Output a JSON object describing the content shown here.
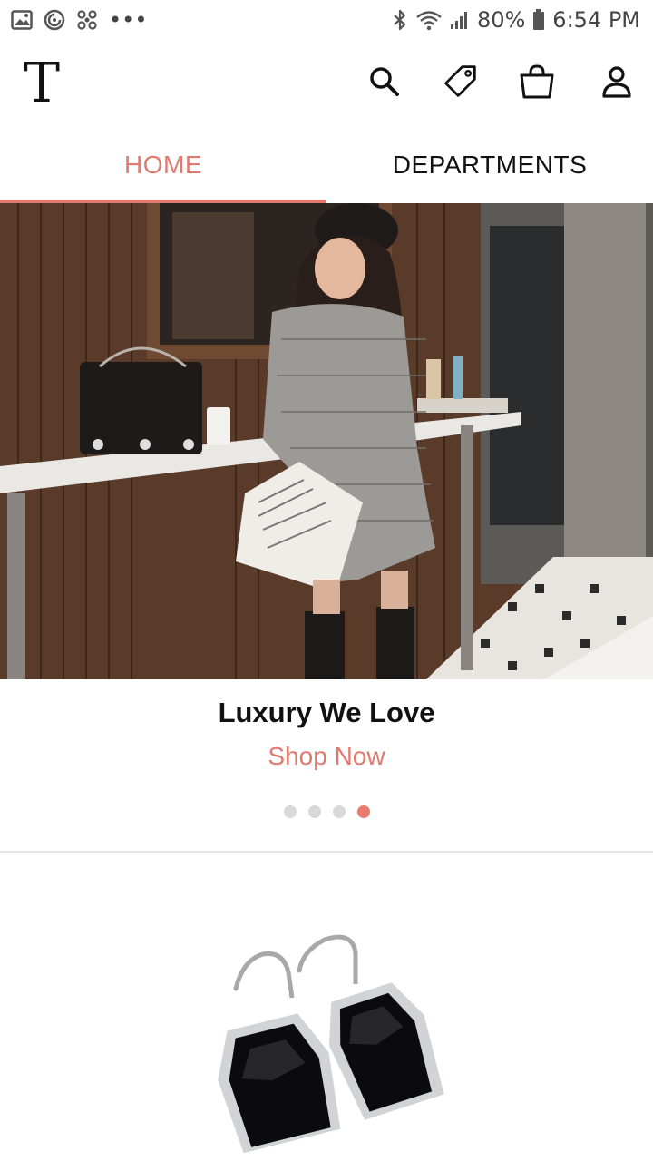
{
  "status_bar": {
    "battery_percent": "80%",
    "time": "6:54 PM",
    "more_label": "•••",
    "icons": [
      "gallery-icon",
      "sync-icon",
      "fan-icon",
      "bluetooth-icon",
      "wifi-icon",
      "signal-icon",
      "battery-icon"
    ]
  },
  "header": {
    "logo_text": "T",
    "icons": [
      "search-icon",
      "tag-icon",
      "shopping-bag-icon",
      "account-icon"
    ]
  },
  "tabs": [
    {
      "label": "HOME",
      "active": true
    },
    {
      "label": "DEPARTMENTS",
      "active": false
    }
  ],
  "promo": {
    "title": "Luxury We Love",
    "link": "Shop Now",
    "page_count": 4,
    "active_page": 4
  },
  "colors": {
    "accent": "#e07a6f",
    "text": "#111111",
    "dot_inactive": "#d9d9d9"
  }
}
